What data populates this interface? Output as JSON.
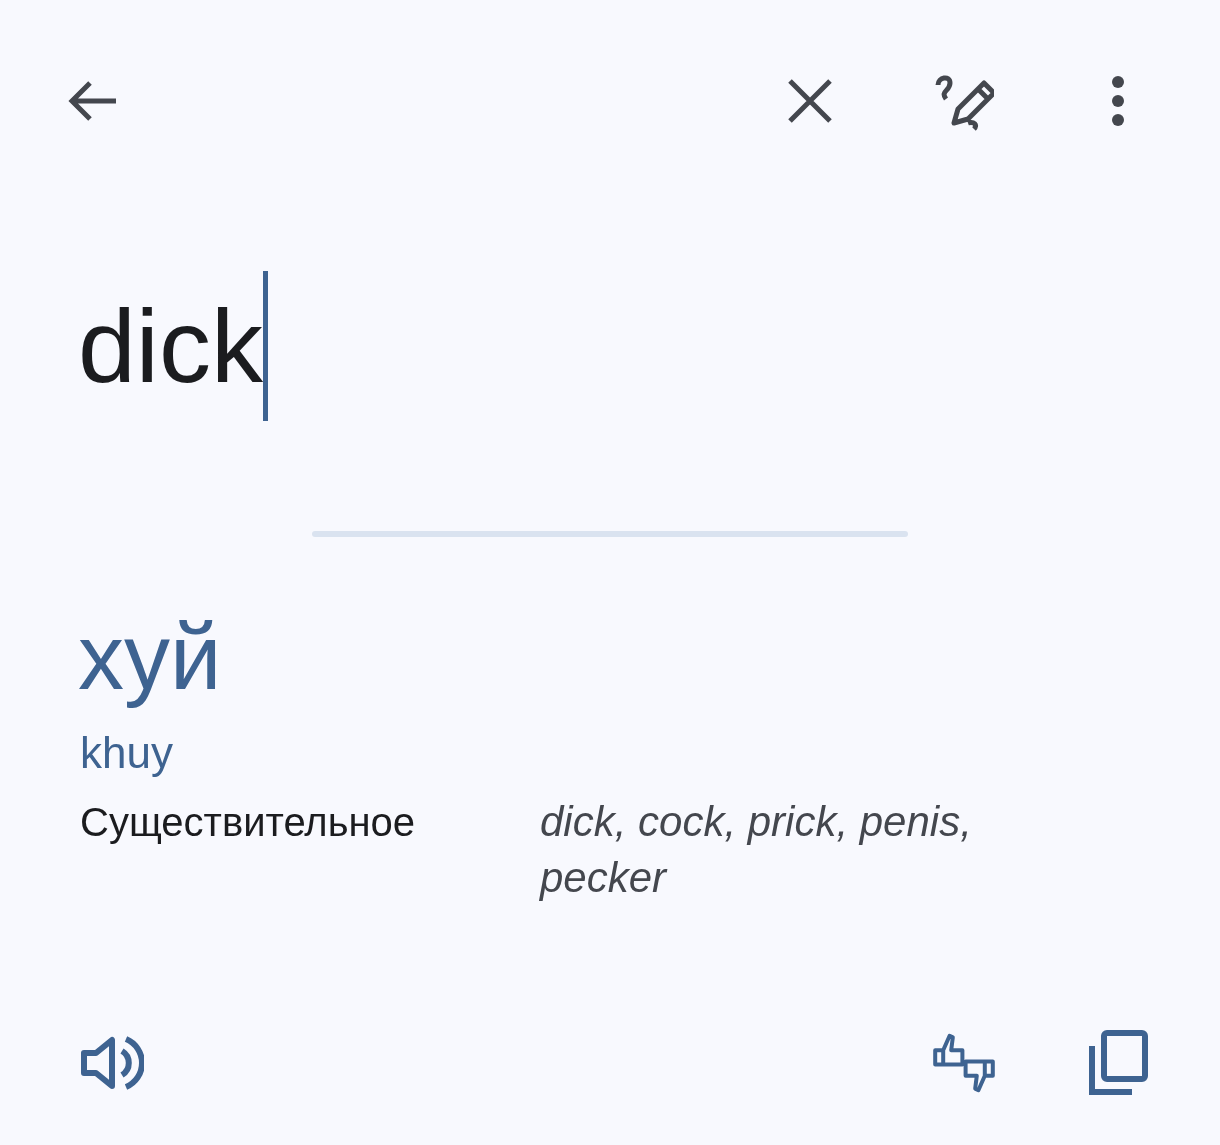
{
  "input": {
    "value": "dick"
  },
  "result": {
    "translation": "хуй",
    "transliteration": "khuy",
    "entries": [
      {
        "part_of_speech": "Существительное",
        "synonyms": "dick, cock, prick, penis, pecker"
      }
    ]
  }
}
